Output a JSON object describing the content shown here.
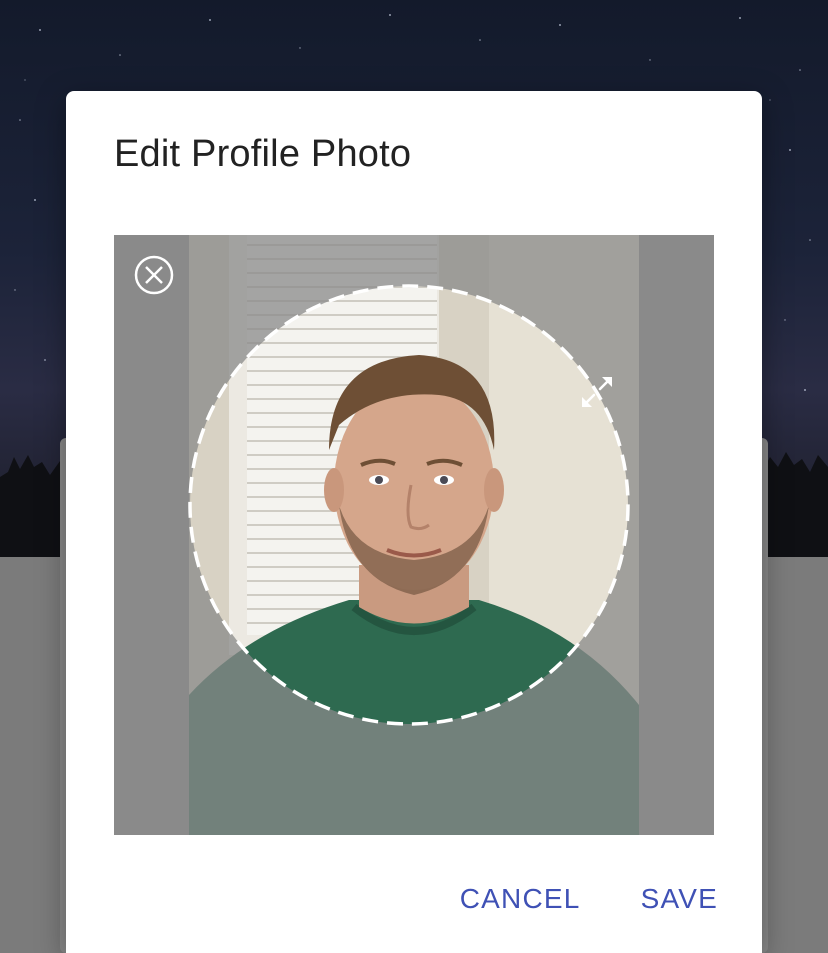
{
  "dialog": {
    "title": "Edit Profile Photo",
    "cancel_label": "CANCEL",
    "save_label": "SAVE"
  },
  "icons": {
    "close": "close-circle-icon",
    "resize": "resize-diagonal-icon"
  },
  "colors": {
    "accent": "#3f51b5",
    "title_text": "#222222",
    "crop_outline": "#ffffff",
    "dimmed_area": "#8a8a8a",
    "shirt": "#2e6a50"
  }
}
